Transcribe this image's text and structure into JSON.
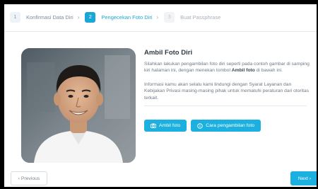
{
  "stepper": {
    "steps": [
      {
        "number": "1",
        "label": "Konfirmasi Data Diri",
        "state": "done"
      },
      {
        "number": "2",
        "label": "Pengecekan Foto Diri",
        "state": "active"
      },
      {
        "number": "3",
        "label": "Buat Passphrase",
        "state": "disabled"
      }
    ],
    "separator_icon": "chevron-right-icon"
  },
  "main": {
    "photo_alt": "portrait-photo",
    "title": "Ambil Foto Diri",
    "instruction_before": "Silahkan lakukan pengambilan foto diri seperti pada contoh gambar di samping kiri halaman ini, dengan menekan tombol ",
    "instruction_bold": "Ambil foto",
    "instruction_after": " di bawah ini.",
    "privacy_note": "Informasi kamu akan selalu kami lindungi dengan Syarat Layanan dan Kebijakan Privasi masing-masing pihak untuk mematuhi peraturan dari otoritas terkait.",
    "buttons": {
      "take_photo": {
        "label": "Ambil foto",
        "icon": "camera-icon"
      },
      "how_to": {
        "label": "Cara pengambilan foto",
        "icon": "info-icon"
      }
    }
  },
  "footer": {
    "previous_label": "‹ Previous",
    "next_label": "Next ›"
  },
  "colors": {
    "accent": "#1bb0df",
    "title_text": "#2f3a44",
    "body_text": "#6d7a86"
  }
}
